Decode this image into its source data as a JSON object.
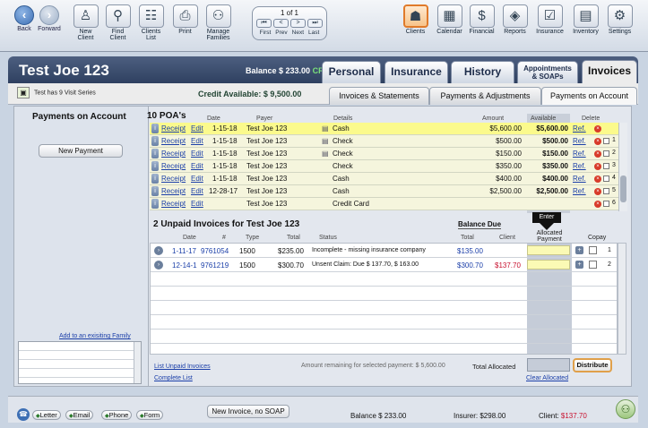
{
  "nav": {
    "back": "Back",
    "forward": "Forward"
  },
  "toolbar_left": [
    {
      "label": "New\nClient",
      "icon": "person-plus-icon",
      "glyph": "♙"
    },
    {
      "label": "Find\nClient",
      "icon": "magnifier-icon",
      "glyph": "⚲"
    },
    {
      "label": "Clients\nList",
      "icon": "people-icon",
      "glyph": "☷"
    },
    {
      "label": "Print",
      "icon": "printer-icon",
      "glyph": "⎙"
    },
    {
      "label": "Manage\nFamilies",
      "icon": "family-icon",
      "glyph": "⚇"
    }
  ],
  "pager": {
    "page": "1 of 1",
    "labels": [
      "First",
      "Prev",
      "Next",
      "Last"
    ],
    "arrows": [
      "⏮",
      "<",
      ">",
      "⏭"
    ]
  },
  "toolbar_right": [
    {
      "label": "Clients",
      "icon": "clients-icon",
      "glyph": "☗",
      "active": true
    },
    {
      "label": "Calendar",
      "icon": "calendar-icon",
      "glyph": "▦"
    },
    {
      "label": "Financial",
      "icon": "dollar-icon",
      "glyph": "$"
    },
    {
      "label": "Reports",
      "icon": "reports-icon",
      "glyph": "◈"
    },
    {
      "label": "Insurance",
      "icon": "insurance-form-icon",
      "glyph": "☑"
    },
    {
      "label": "Inventory",
      "icon": "inventory-icon",
      "glyph": "▤"
    },
    {
      "label": "Settings",
      "icon": "gear-icon",
      "glyph": "⚙"
    }
  ],
  "patient": {
    "name": "Test Joe 123",
    "balance_label": "Balance $ 233.00",
    "balance_flag": "CR"
  },
  "main_tabs": [
    "Personal",
    "Insurance",
    "History",
    "Appointments\n& SOAPs",
    "Invoices"
  ],
  "visit_series": "Test has 9 Visit Series",
  "credit_available": "Credit Available: $ 9,500.00",
  "sub_tabs": [
    "Invoices & Statements",
    "Payments & Adjustments",
    "Payments on Account"
  ],
  "left": {
    "title": "Payments on Account",
    "new_payment": "New Payment",
    "add_family": "Add to an exisiting Family"
  },
  "poa": {
    "count_label": "10 POA's",
    "headers": {
      "date": "Date",
      "payer": "Payer",
      "details": "Details",
      "amount": "Amount",
      "available": "Available",
      "delete": "Delete"
    },
    "rows": [
      {
        "date": "1-15-18",
        "payer": "Test Joe 123",
        "details": "Cash",
        "amount": "$5,600.00",
        "available": "$5,600.00",
        "num": "",
        "icon": true
      },
      {
        "date": "1-15-18",
        "payer": "Test Joe 123",
        "details": "Check",
        "amount": "$500.00",
        "available": "$500.00",
        "num": "1",
        "icon": true
      },
      {
        "date": "1-15-18",
        "payer": "Test Joe 123",
        "details": "Check",
        "amount": "$150.00",
        "available": "$150.00",
        "num": "2",
        "icon": true
      },
      {
        "date": "1-15-18",
        "payer": "Test Joe 123",
        "details": "Check",
        "amount": "$350.00",
        "available": "$350.00",
        "num": "3",
        "icon": false
      },
      {
        "date": "1-15-18",
        "payer": "Test Joe 123",
        "details": "Cash",
        "amount": "$400.00",
        "available": "$400.00",
        "num": "4",
        "icon": false
      },
      {
        "date": "12-28-17",
        "payer": "Test Joe 123",
        "details": "Cash",
        "amount": "$2,500.00",
        "available": "$2,500.00",
        "num": "5",
        "icon": false
      },
      {
        "date": "",
        "payer": "Test Joe 123",
        "details": "Credit Card",
        "amount": "",
        "available": "",
        "num": "6",
        "icon": false
      }
    ],
    "receipt": "Receipt",
    "edit": "Edit",
    "ref": "Ref."
  },
  "unpaid": {
    "title": "2 Unpaid Invoices for Test Joe 123",
    "balance_due": "Balance Due",
    "enter": "Enter",
    "allocated_payment": "Allocated\nPayment",
    "copay": "Copay",
    "headers": {
      "date": "Date",
      "num": "#",
      "type": "Type",
      "total": "Total",
      "status": "Status",
      "bd_total": "Total",
      "bd_client": "Client"
    },
    "rows": [
      {
        "date": "1-11-17",
        "num": "9761054",
        "type": "1500",
        "total": "$235.00",
        "status": "Incomplete - missing insurance company",
        "bd_total": "$135.00",
        "bd_client": "",
        "idx": "1"
      },
      {
        "date": "12-14-1",
        "num": "9761219",
        "type": "1500",
        "total": "$300.70",
        "status": "Unsent Claim: Due $ 137.70, $ 163.00",
        "bd_total": "$300.70",
        "bd_client": "$137.70",
        "idx": "2"
      }
    ],
    "list_unpaid": "List Unpaid Invoices",
    "complete_list": "Complete List",
    "remaining": "Amount remaining for selected payment: $ 5,600.00",
    "total_allocated": "Total Allocated",
    "distribute": "Distribute",
    "clear_allocated": "Clear Allocated"
  },
  "footer": {
    "buttons": [
      "Letter",
      "Email",
      "Phone",
      "Form"
    ],
    "new_invoice": "New Invoice, no SOAP",
    "balance": "Balance $ 233.00",
    "insurer": "Insurer: $298.00",
    "client_label": "Client: ",
    "client_value": "$137.70"
  },
  "colors": {
    "accent": "#e07a2a",
    "link": "#1a3ea8",
    "alert": "#c8102e",
    "header": "#2f4060",
    "selected_row": "#fbfa8c"
  }
}
